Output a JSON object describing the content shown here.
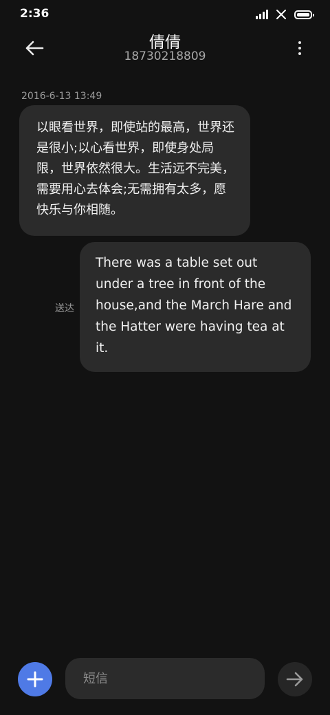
{
  "status_bar": {
    "time": "2:36"
  },
  "header": {
    "contact_name": "倩倩",
    "contact_number": "18730218809",
    "icons": {
      "back": "back-arrow-icon",
      "more": "more-vertical-icon"
    }
  },
  "conversation": {
    "timestamp": "2016-6-13 13:49",
    "messages": [
      {
        "direction": "incoming",
        "text": "以眼看世界，即使站的最高，世界还是很小;以心看世界，即使身处局限，世界依然很大。生活远不完美，需要用心去体会;无需拥有太多，愿快乐与你相随。"
      },
      {
        "direction": "outgoing",
        "text": "There was a table set out under a tree in front of the house,and the March Hare and the Hatter were having tea at it.",
        "status": "送达"
      }
    ]
  },
  "composer": {
    "placeholder": "短信",
    "value": "",
    "icons": {
      "add": "plus-icon",
      "send": "send-arrow-icon"
    },
    "colors": {
      "add_button": "#4f7ae6",
      "send_button": "#262626"
    }
  },
  "colors": {
    "background": "#121212",
    "bubble": "#2b2b2b",
    "secondary_text": "#9a9a9a"
  }
}
